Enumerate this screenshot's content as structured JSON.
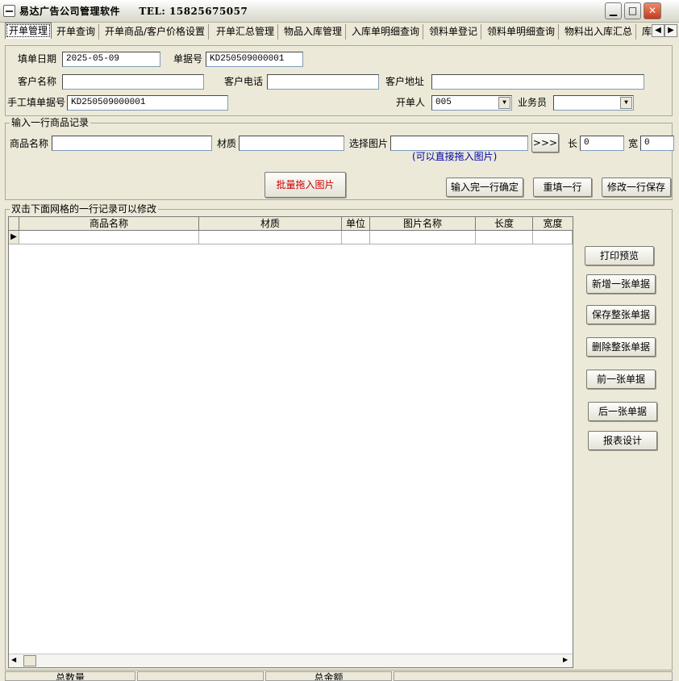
{
  "window": {
    "title": "易达广告公司管理软件",
    "tel": "TEL: 15825675057",
    "minimize_glyph": "▁",
    "maximize_glyph": "□",
    "close_glyph": "✕"
  },
  "tabs": [
    "开单管理",
    "开单查询",
    "开单商品/客户价格设置",
    "开单汇总管理",
    "物品入库管理",
    "入库单明细查询",
    "领料单登记",
    "领料单明细查询",
    "物料出入库汇总",
    "库"
  ],
  "tab_scroll": {
    "left_glyph": "◀",
    "right_glyph": "▶"
  },
  "order_header": {
    "date_label": "填单日期",
    "date_value": "2025-05-09",
    "number_label": "单据号",
    "number_value": "KD250509000001",
    "customer_name_label": "客户名称",
    "customer_name_value": "",
    "customer_phone_label": "客户电话",
    "customer_phone_value": "",
    "customer_address_label": "客户地址",
    "customer_address_value": "",
    "manual_number_label": "手工填单据号",
    "manual_number_value": "KD250509000001",
    "issuer_label": "开单人",
    "issuer_value": "005",
    "salesman_label": "业务员",
    "salesman_value": "",
    "dropdown_glyph": "▼"
  },
  "input_row": {
    "legend": "输入一行商品记录",
    "product_name_label": "商品名称",
    "material_label": "材质",
    "image_label": "选择图片",
    "browse_label": ">>>",
    "length_label": "长",
    "length_value": "0",
    "width_label": "宽",
    "width_value": "0",
    "drag_hint": "(可以直接拖入图片)",
    "batch_drag_label": "批量拖入图片",
    "confirm_row_label": "输入完一行确定",
    "refill_label": "重填一行",
    "modify_save_label": "修改一行保存"
  },
  "grid": {
    "legend": "双击下面网格的一行记录可以修改",
    "columns": [
      "商品名称",
      "材质",
      "单位",
      "图片名称",
      "长度",
      "宽度"
    ],
    "current_row_glyph": "▶",
    "scroll_left_glyph": "◀",
    "scroll_right_glyph": "▶"
  },
  "side_buttons": {
    "print_preview": "打印预览",
    "new_order": "新增一张单据",
    "save_order": "保存整张单据",
    "delete_order": "删除整张单据",
    "prev_order": "前一张单据",
    "next_order": "后一张单据",
    "report_design": "报表设计"
  },
  "status": {
    "total_qty_label": "总数量",
    "total_amount_label": "总金额"
  },
  "colors": {
    "window_bg": "#ece9d8",
    "batch_button_text": "#cc0000",
    "hint_text": "#0000aa",
    "close_button": "#c8391a"
  }
}
